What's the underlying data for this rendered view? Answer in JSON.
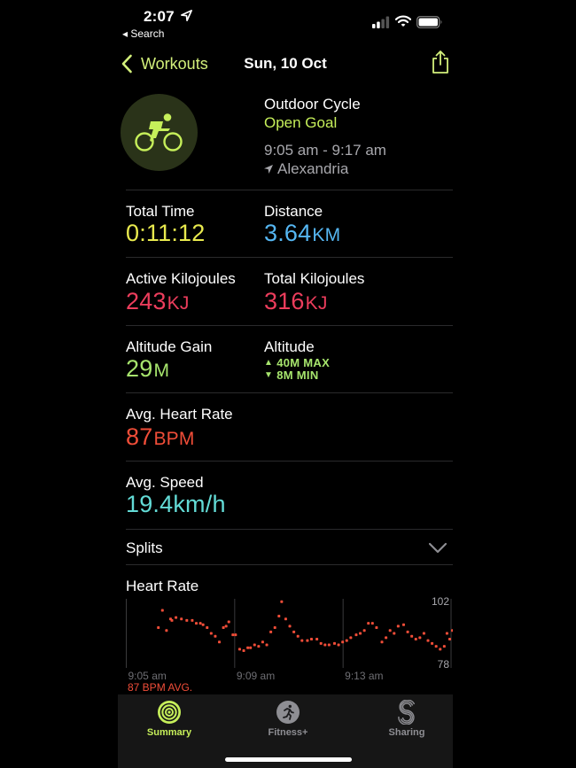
{
  "status_bar": {
    "time": "2:07",
    "back_app": "◂ Search"
  },
  "nav": {
    "back_label": "Workouts",
    "title": "Sun, 10 Oct"
  },
  "workout": {
    "type": "Outdoor Cycle",
    "goal": "Open Goal",
    "time_range": "9:05 am - 9:17 am",
    "location": "Alexandria",
    "icon": "cycling-icon"
  },
  "metrics": {
    "total_time": {
      "label": "Total Time",
      "value": "0:11:12",
      "unit": ""
    },
    "distance": {
      "label": "Distance",
      "value": "3.64",
      "unit": "KM"
    },
    "active_kj": {
      "label": "Active Kilojoules",
      "value": "243",
      "unit": "KJ"
    },
    "total_kj": {
      "label": "Total Kilojoules",
      "value": "316",
      "unit": "KJ"
    },
    "altitude_gain": {
      "label": "Altitude Gain",
      "value": "29",
      "unit": "M"
    },
    "altitude": {
      "label": "Altitude",
      "max": "40M MAX",
      "min": "8M MIN"
    },
    "avg_heart_rate": {
      "label": "Avg. Heart Rate",
      "value": "87",
      "unit": "BPM"
    },
    "avg_speed": {
      "label": "Avg. Speed",
      "value": "19.4",
      "unit": "km/h"
    }
  },
  "splits": {
    "label": "Splits"
  },
  "heart_rate": {
    "title": "Heart Rate",
    "avg_label": "87 BPM AVG."
  },
  "colors": {
    "accent": "#d3f07b",
    "goal_green": "#c6ef5a",
    "time_yellow": "#e8e94e",
    "distance_blue": "#55b6f2",
    "energy_red": "#ec3d5c",
    "altitude_green": "#a7e56d",
    "heart_red": "#f04d38",
    "speed_cyan": "#63dbd6"
  },
  "chart_data": {
    "type": "scatter",
    "title": "Heart Rate",
    "x_ticks": [
      "9:05 am",
      "9:09 am",
      "9:13 am"
    ],
    "y_ticks": [
      102,
      78
    ],
    "ylim": [
      78,
      102
    ],
    "xlim_minutes": [
      0,
      12
    ],
    "annotation": "87 BPM AVG.",
    "series": [
      {
        "name": "Heart Rate (BPM)",
        "points": [
          [
            1.2,
            92
          ],
          [
            1.35,
            98
          ],
          [
            1.5,
            91
          ],
          [
            1.65,
            95
          ],
          [
            1.7,
            94.5
          ],
          [
            1.85,
            95.5
          ],
          [
            2.05,
            95
          ],
          [
            2.25,
            94.5
          ],
          [
            2.45,
            94.5
          ],
          [
            2.6,
            93.5
          ],
          [
            2.75,
            93.5
          ],
          [
            2.85,
            93
          ],
          [
            3.0,
            92
          ],
          [
            3.15,
            90
          ],
          [
            3.3,
            89
          ],
          [
            3.45,
            87
          ],
          [
            3.6,
            92
          ],
          [
            3.7,
            92.5
          ],
          [
            3.8,
            94
          ],
          [
            3.95,
            89.5
          ],
          [
            4.05,
            89.5
          ],
          [
            4.2,
            84.5
          ],
          [
            4.35,
            84
          ],
          [
            4.5,
            85
          ],
          [
            4.6,
            85
          ],
          [
            4.75,
            86
          ],
          [
            4.9,
            85.5
          ],
          [
            5.05,
            87
          ],
          [
            5.2,
            86
          ],
          [
            5.35,
            90.5
          ],
          [
            5.5,
            92
          ],
          [
            5.65,
            96
          ],
          [
            5.75,
            101
          ],
          [
            5.9,
            95
          ],
          [
            6.05,
            92.5
          ],
          [
            6.2,
            90.5
          ],
          [
            6.35,
            89
          ],
          [
            6.5,
            87.5
          ],
          [
            6.7,
            87.5
          ],
          [
            6.85,
            88
          ],
          [
            7.05,
            88
          ],
          [
            7.2,
            86.5
          ],
          [
            7.35,
            86
          ],
          [
            7.5,
            86
          ],
          [
            7.7,
            86.5
          ],
          [
            7.85,
            86
          ],
          [
            8.0,
            87
          ],
          [
            8.15,
            87.5
          ],
          [
            8.3,
            88.5
          ],
          [
            8.5,
            89.5
          ],
          [
            8.65,
            90
          ],
          [
            8.8,
            91
          ],
          [
            8.95,
            93.5
          ],
          [
            9.1,
            93.5
          ],
          [
            9.25,
            92
          ],
          [
            9.45,
            87
          ],
          [
            9.6,
            88.5
          ],
          [
            9.75,
            91
          ],
          [
            9.9,
            90
          ],
          [
            10.05,
            92.5
          ],
          [
            10.25,
            93
          ],
          [
            10.4,
            90.5
          ],
          [
            10.55,
            89
          ],
          [
            10.7,
            88
          ],
          [
            10.85,
            88.5
          ],
          [
            11.0,
            90
          ],
          [
            11.15,
            87.5
          ],
          [
            11.3,
            86.5
          ],
          [
            11.45,
            85.5
          ],
          [
            11.6,
            84.5
          ],
          [
            11.75,
            85.5
          ],
          [
            11.85,
            90
          ],
          [
            11.95,
            88
          ],
          [
            12.05,
            91
          ]
        ]
      }
    ]
  },
  "tabs": [
    {
      "label": "Summary",
      "active": true
    },
    {
      "label": "Fitness+",
      "active": false
    },
    {
      "label": "Sharing",
      "active": false
    }
  ]
}
